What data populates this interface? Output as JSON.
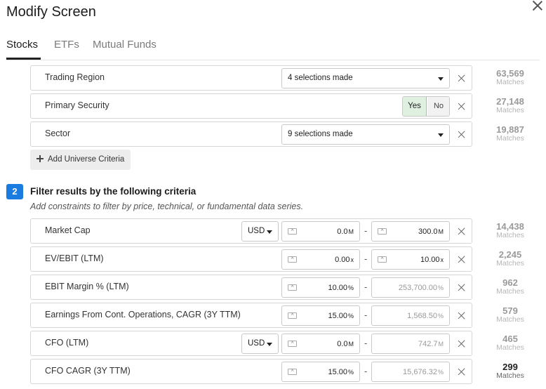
{
  "title": "Modify Screen",
  "tabs": [
    {
      "label": "Stocks",
      "active": true
    },
    {
      "label": "ETFs",
      "active": false
    },
    {
      "label": "Mutual Funds",
      "active": false
    }
  ],
  "universe": {
    "trading_region": {
      "label": "Trading Region",
      "value": "4 selections made",
      "matches": "63,569"
    },
    "primary_security": {
      "label": "Primary Security",
      "yes": "Yes",
      "no": "No",
      "selected": "Yes",
      "matches": "27,148"
    },
    "sector": {
      "label": "Sector",
      "value": "9 selections made",
      "matches": "19,887"
    },
    "add_label": "Add Universe Criteria"
  },
  "matches_label": "Matches",
  "section2": {
    "step": "2",
    "title": "Filter results by the following criteria",
    "description": "Add constraints to filter by price, technical, or fundamental data series."
  },
  "criteria": [
    {
      "label": "Market Cap",
      "currency": "USD",
      "from": "0.0",
      "from_unit": "M",
      "to": "300.0",
      "to_unit": "M",
      "matches": "14,438"
    },
    {
      "label": "EV/EBIT (LTM)",
      "from": "0.00",
      "from_unit": "x",
      "to": "10.00",
      "to_unit": "x",
      "matches": "2,245"
    },
    {
      "label": "EBIT Margin % (LTM)",
      "from": "10.00",
      "from_unit": "%",
      "to_placeholder": "253,700.00",
      "to_unit": "%",
      "matches": "962"
    },
    {
      "label": "Earnings From Cont. Operations, CAGR (3Y TTM)",
      "from": "15.00",
      "from_unit": "%",
      "to_placeholder": "1,568.50",
      "to_unit": "%",
      "matches": "579"
    },
    {
      "label": "CFO (LTM)",
      "currency": "USD",
      "from": "0.0",
      "from_unit": "M",
      "to_placeholder": "742.7",
      "to_unit": "M",
      "matches": "465"
    },
    {
      "label": "CFO CAGR (3Y TTM)",
      "from": "15.00",
      "from_unit": "%",
      "to_placeholder": "15,676.32",
      "to_unit": "%",
      "matches": "299"
    }
  ]
}
